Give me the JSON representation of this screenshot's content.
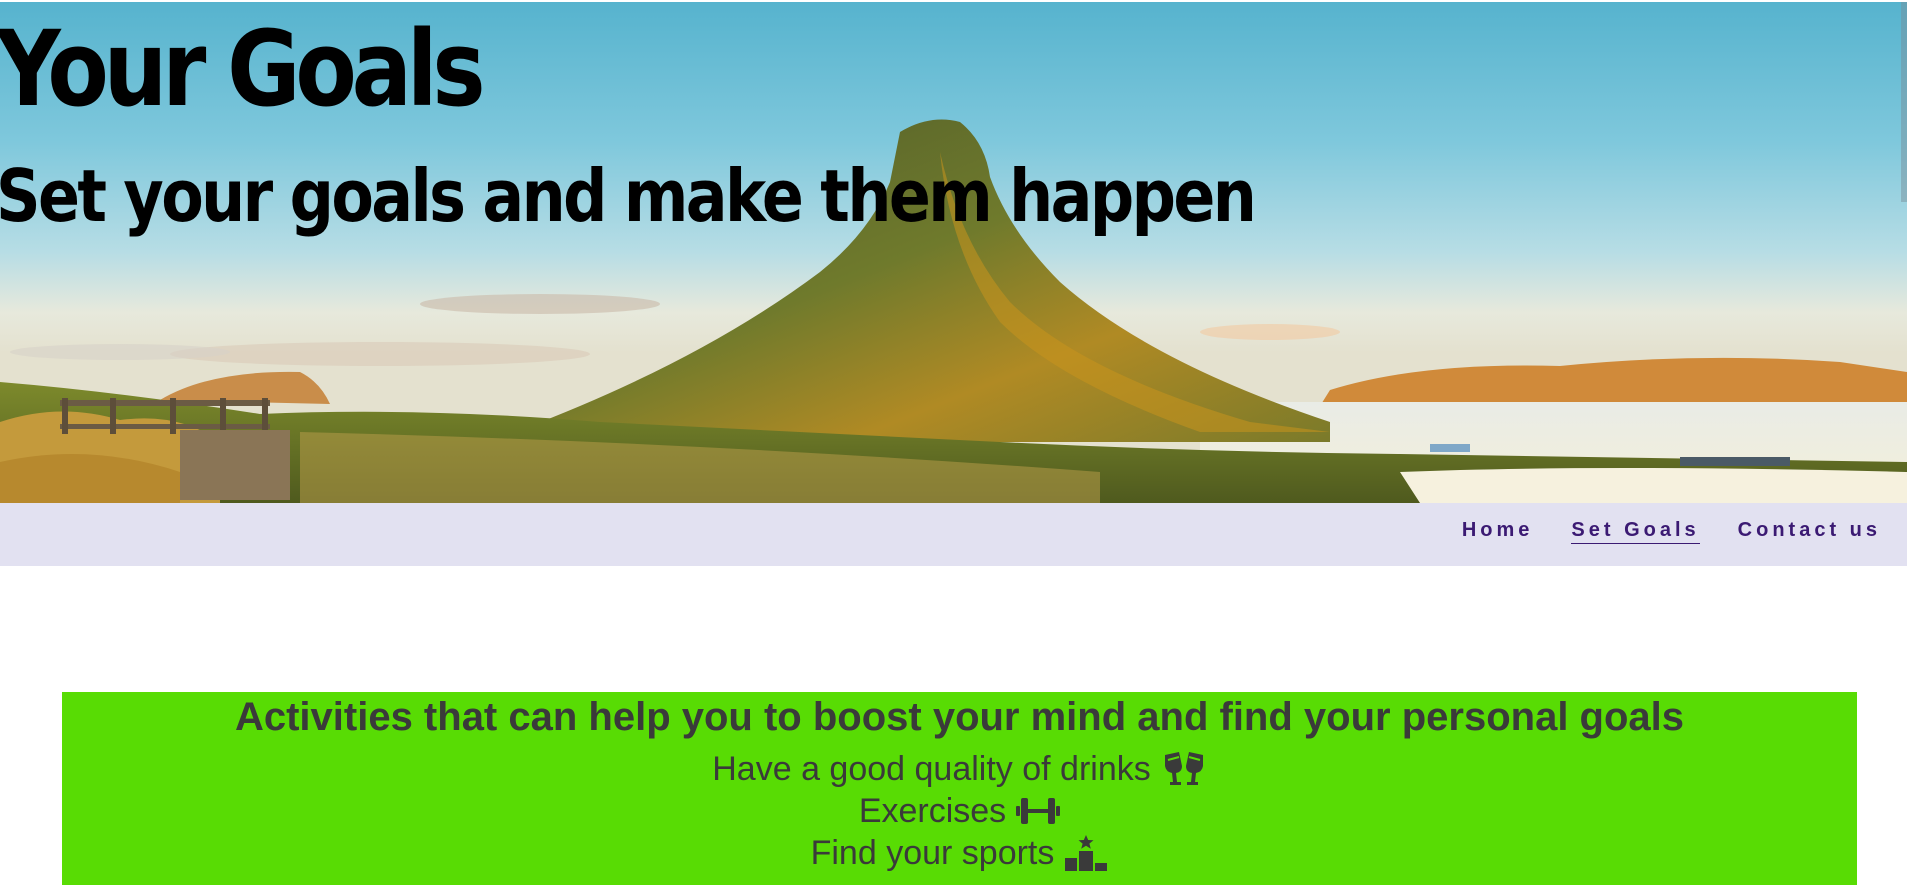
{
  "hero": {
    "title": "Your Goals",
    "subtitle": "Set your goals and make them happen",
    "background": "mountain-landscape"
  },
  "nav": {
    "items": [
      {
        "label": "Home",
        "active": false
      },
      {
        "label": "Set Goals",
        "active": true
      },
      {
        "label": "Contact us",
        "active": false
      }
    ]
  },
  "activities": {
    "heading": "Activities that can help you to boost your mind and find your personal goals",
    "items": [
      {
        "label": "Have a good quality of drinks",
        "icon": "glasses-cheers-icon"
      },
      {
        "label": "Exercises",
        "icon": "dumbbell-icon"
      },
      {
        "label": "Find your sports",
        "icon": "ranking-podium-star-icon"
      }
    ]
  },
  "colors": {
    "nav_background": "#e2e1f1",
    "nav_text": "#3b1a73",
    "activities_background": "#58dc04",
    "activities_text": "#3a3a3a"
  }
}
